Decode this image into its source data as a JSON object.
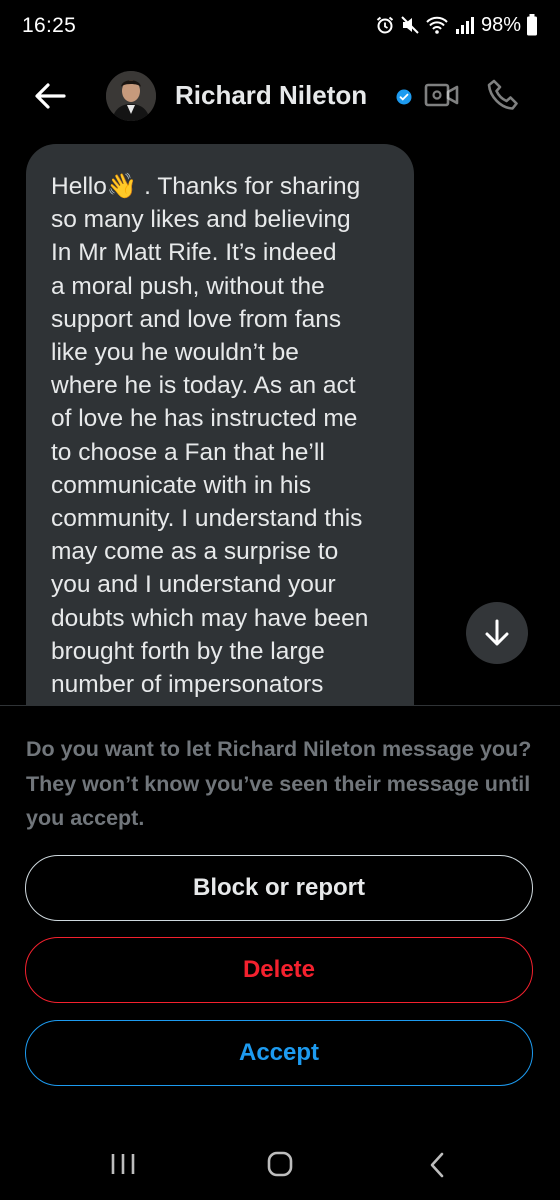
{
  "status_bar": {
    "time": "16:25",
    "battery": "98%",
    "icons": [
      "alarm-icon",
      "mute-icon",
      "wifi-icon",
      "signal-icon",
      "battery-icon"
    ]
  },
  "header": {
    "contact_name": "Richard Nileton",
    "icons": [
      "back-arrow-icon",
      "verified-badge-icon",
      "video-call-icon",
      "phone-call-icon"
    ]
  },
  "message": {
    "text": "Hello👋 . Thanks for sharing\nso many likes and believing\nIn Mr Matt Rife. It’s indeed\na moral push, without the\nsupport and love from fans\nlike you he wouldn’t be\nwhere he is today. As an act\nof love he has instructed me\nto choose a Fan that he’ll\ncommunicate with in his\ncommunity. I understand this\nmay come as a surprise to\nyou and I understand your\ndoubts which may have been\nbrought forth by the large\nnumber of impersonators\nbut one of that isn’t gonna be"
  },
  "request": {
    "prompt": "Do you want to let Richard Nileton message you? They won’t know you’ve seen their message until you accept.",
    "block_label": "Block or report",
    "delete_label": "Delete",
    "accept_label": "Accept"
  },
  "colors": {
    "background": "#000000",
    "bubble": "#2f3336",
    "accent": "#1d9bf0",
    "danger": "#f4212e"
  }
}
